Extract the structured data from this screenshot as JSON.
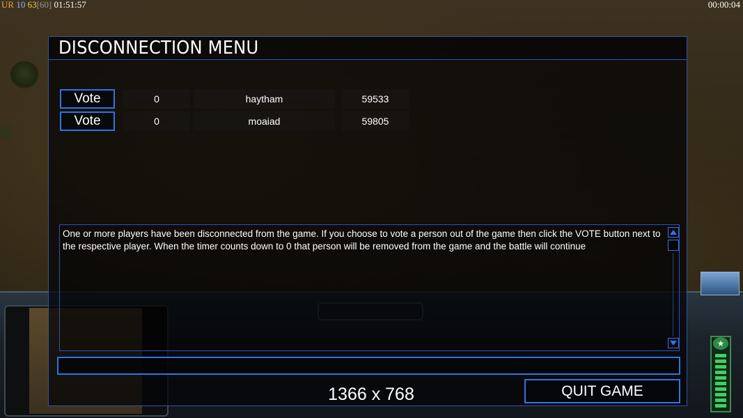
{
  "hud": {
    "seg1": "UR",
    "seg2": "10",
    "seg3": "63",
    "seg4": "[60]",
    "clock": "01:51:57",
    "timer": "00:00:04"
  },
  "dialog": {
    "title": "DISCONNECTION MENU",
    "players": [
      {
        "vote_label": "Vote",
        "count": "0",
        "name": "haytham",
        "ping": "59533"
      },
      {
        "vote_label": "Vote",
        "count": "0",
        "name": "moaiad",
        "ping": "59805"
      }
    ],
    "message": "One or more players have been disconnected from the game. If you choose to vote a person out of the game then click the VOTE button next to the respective player. When the timer counts down to 0 that person will be removed from the game and the battle will continue",
    "chat_value": "",
    "quit_label": "QUIT GAME",
    "resolution": "1366 x 768"
  },
  "colors": {
    "accent_border": "#2e74e6",
    "panel_bg": "#050608"
  }
}
